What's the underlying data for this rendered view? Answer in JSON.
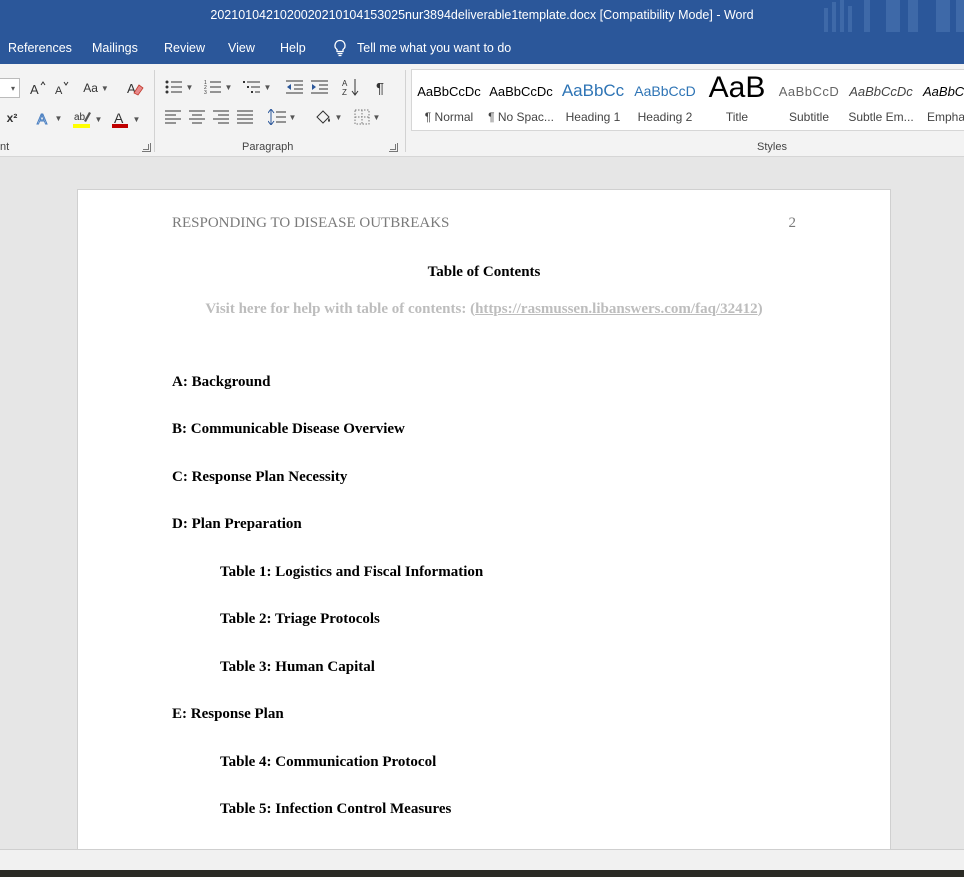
{
  "window": {
    "title": "20210104210200202101041530​25nur3894deliverable1template.docx [Compatibility Mode]  -  Word"
  },
  "menu": {
    "tabs": [
      "References",
      "Mailings",
      "Review",
      "View",
      "Help"
    ],
    "tell_me": "Tell me what you want to do"
  },
  "ribbon": {
    "groups": {
      "font": "nt",
      "paragraph": "Paragraph",
      "styles": "Styles"
    },
    "font_buttons": {
      "change_case": "Aa",
      "superscript": "x²"
    },
    "styles": [
      {
        "sample": "AaBbCcDc",
        "name": "¶ Normal"
      },
      {
        "sample": "AaBbCcDc",
        "name": "¶ No Spac..."
      },
      {
        "sample": "AaBbCc",
        "name": "Heading 1"
      },
      {
        "sample": "AaBbCcD",
        "name": "Heading 2"
      },
      {
        "sample": "AaB",
        "name": "Title"
      },
      {
        "sample": "AaBbCcD",
        "name": "Subtitle"
      },
      {
        "sample": "AaBbCcDc",
        "name": "Subtle Em..."
      },
      {
        "sample": "AaBbC",
        "name": "Empha"
      }
    ],
    "colors": {
      "highlight": "#ffff00",
      "font_color": "#c00000"
    }
  },
  "document": {
    "running_head": "RESPONDING TO DISEASE OUTBREAKS",
    "page_number": "2",
    "toc_title": "Table of Contents",
    "help_prefix": "Visit here for help with table of contents: (",
    "help_link": "https://rasmussen.libanswers.com/faq/32412",
    "help_suffix": ")",
    "entries": [
      "A: Background",
      "B: Communicable Disease Overview",
      "C: Response Plan Necessity",
      "D: Plan Preparation",
      "Table 1: Logistics and Fiscal Information",
      "Table 2: Triage Protocols",
      "Table 3: Human Capital",
      "E: Response Plan",
      "Table 4: Communication Protocol",
      "Table 5: Infection Control Measures"
    ]
  },
  "theme": {
    "accent": "#2b579a"
  }
}
